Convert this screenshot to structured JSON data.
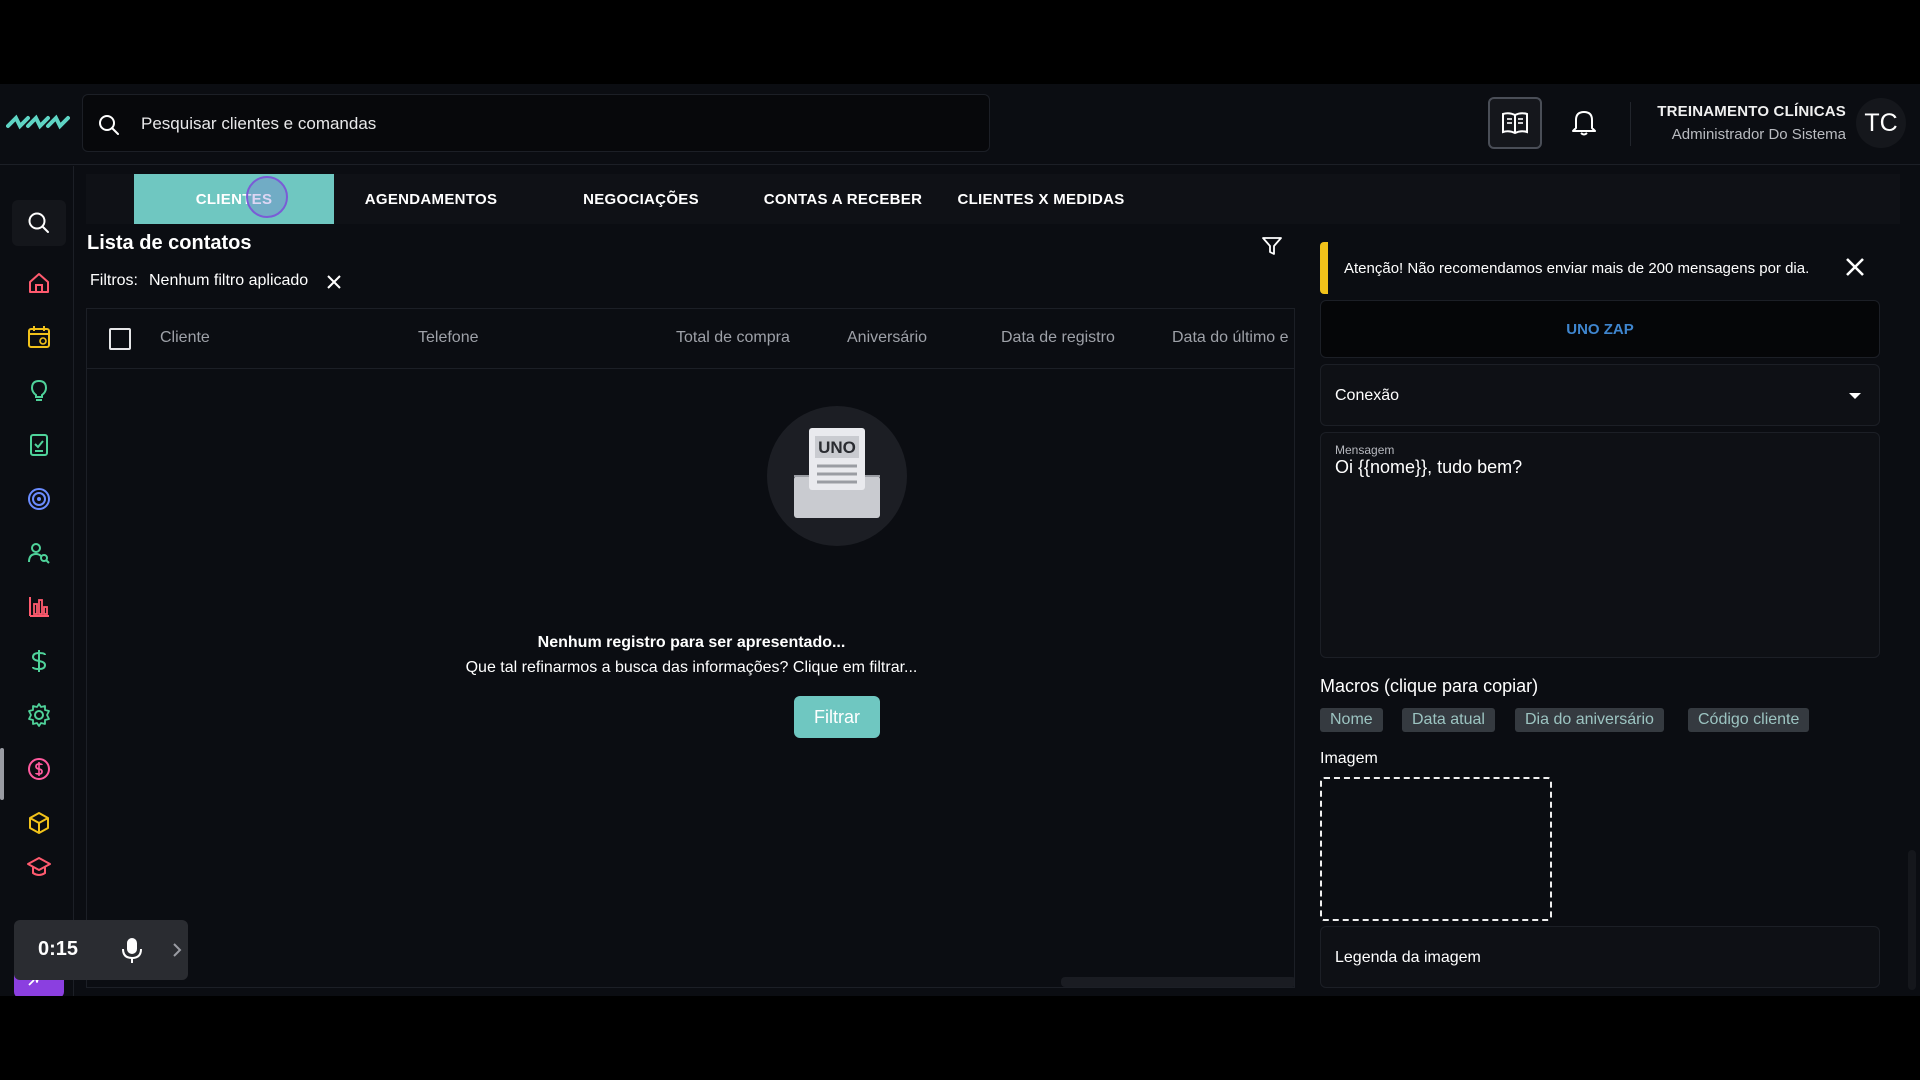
{
  "search": {
    "placeholder": "Pesquisar clientes e comandas"
  },
  "user": {
    "name": "TREINAMENTO CLÍNICAS",
    "role": "Administrador Do Sistema",
    "initials": "TC"
  },
  "tabs": [
    {
      "label": "CLIENTES",
      "active": true
    },
    {
      "label": "AGENDAMENTOS"
    },
    {
      "label": "NEGOCIAÇÕES"
    },
    {
      "label": "CONTAS A RECEBER"
    },
    {
      "label": "CLIENTES X MEDIDAS"
    }
  ],
  "sidebar": {
    "items": [
      {
        "icon": "search-icon"
      },
      {
        "icon": "home-icon"
      },
      {
        "icon": "calendar-icon"
      },
      {
        "icon": "lightbulb-icon"
      },
      {
        "icon": "checklist-icon"
      },
      {
        "icon": "target-icon"
      },
      {
        "icon": "users-search-icon"
      },
      {
        "icon": "bar-chart-icon"
      },
      {
        "icon": "dollar-icon"
      },
      {
        "icon": "gear-icon",
        "active": true
      },
      {
        "icon": "coin-icon"
      },
      {
        "icon": "box-icon"
      },
      {
        "icon": "graduation-cap-icon"
      },
      {
        "icon": "sparkles-icon"
      }
    ]
  },
  "contacts": {
    "title": "Lista de contatos",
    "filters_label": "Filtros:",
    "filters_value": "Nenhum filtro aplicado",
    "columns": [
      "Cliente",
      "Telefone",
      "Total de compra",
      "Aniversário",
      "Data de registro",
      "Data do último e"
    ],
    "rows": [],
    "empty_logo_text": "UNO",
    "empty_title": "Nenhum registro para ser apresentado...",
    "empty_subtitle": "Que tal refinarmos a busca das informações? Clique em filtrar...",
    "filter_button": "Filtrar"
  },
  "messaging": {
    "warning": "Atenção! Não recomendamos enviar mais de 200 mensagens por dia.",
    "provider_button": "UNO ZAP",
    "connection_label": "Conexão",
    "message_caption": "Mensagem",
    "message_value": "Oi {{nome}}, tudo bem?",
    "macros_title": "Macros (clique para copiar)",
    "macros": [
      "Nome",
      "Data atual",
      "Dia do aniversário",
      "Código cliente"
    ],
    "image_title": "Imagem",
    "image_caption_label": "Legenda da imagem"
  },
  "recorder": {
    "time": "0:15"
  },
  "colors": {
    "accent_teal": "#6fc7c1",
    "warning_yellow": "#f2c21a",
    "link_blue": "#3f86cf",
    "ai_purple": "#8b3fe0",
    "icon_green": "#4fd29a"
  }
}
